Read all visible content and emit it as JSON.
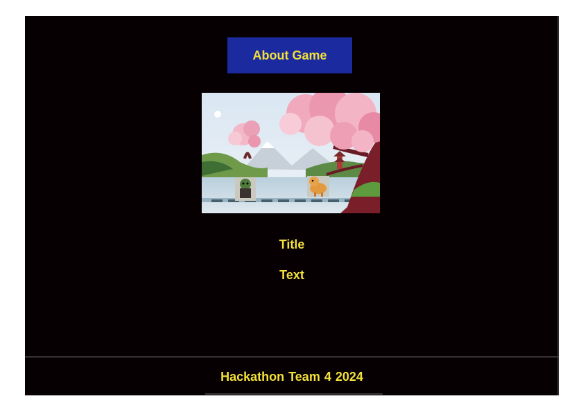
{
  "header": {
    "about_button_label": "About Game"
  },
  "hero_image": {
    "description_icon": "game-scene-image"
  },
  "content": {
    "title": "Title",
    "text": "Text"
  },
  "footer": {
    "text": "Hackathon Team 4  2024"
  },
  "colors": {
    "background": "#060002",
    "accent_text": "#f2e03a",
    "button_bg": "#1c2aa0"
  }
}
